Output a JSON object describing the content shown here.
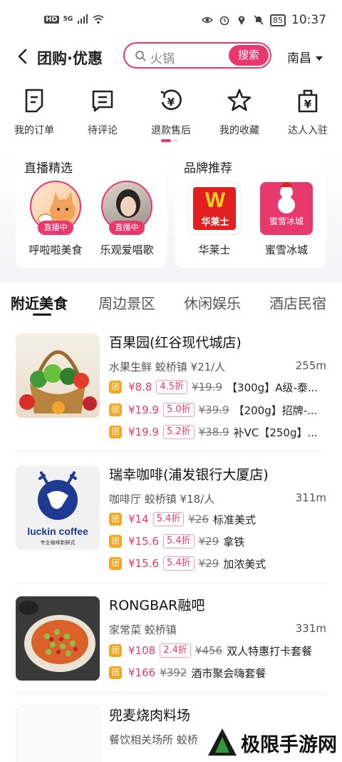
{
  "status_bar": {
    "left_icons": [
      "HD",
      "5G",
      "signal-icon",
      "wifi-icon"
    ],
    "battery": "85",
    "time": "10:37"
  },
  "header": {
    "title": "团购·优惠",
    "search_text": "火锅",
    "search_button": "搜索",
    "city": "南昌"
  },
  "quick_nav": [
    {
      "label": "我的订单",
      "icon": "order-icon"
    },
    {
      "label": "待评论",
      "icon": "comment-icon"
    },
    {
      "label": "退款售后",
      "icon": "refund-icon"
    },
    {
      "label": "我的收藏",
      "icon": "star-icon"
    },
    {
      "label": "达人入驻",
      "icon": "bag-icon"
    }
  ],
  "live_section": {
    "title": "直播精选",
    "items": [
      {
        "name": "呼啦啦美食",
        "tag": "直播中"
      },
      {
        "name": "乐观爱唱歌",
        "tag": "直播中"
      }
    ]
  },
  "brand_section": {
    "title": "品牌推荐",
    "items": [
      {
        "name": "华莱士",
        "logo_text": "华莱士",
        "logo_mark": "W"
      },
      {
        "name": "蜜雪冰城",
        "logo_text": "蜜雪冰城"
      }
    ]
  },
  "tabs": [
    "附近美食",
    "周边景区",
    "休闲娱乐",
    "酒店民宿"
  ],
  "stores": [
    {
      "name": "百果园(红谷现代城店)",
      "category": "水果生鲜 蛟桥镇 ¥21/人",
      "distance": "255m",
      "deals": [
        {
          "price": "¥8.8",
          "discount": "4.5折",
          "original": "¥19.9",
          "title": "【300g】A级-泰..."
        },
        {
          "price": "¥19.9",
          "discount": "5.0折",
          "original": "¥39.9",
          "title": "【200g】招牌-..."
        },
        {
          "price": "¥19.9",
          "discount": "5.2折",
          "original": "¥38.9",
          "title": "补VC【250g】..."
        }
      ]
    },
    {
      "name": "瑞幸咖啡(浦发银行大厦店)",
      "category": "咖啡厅 蛟桥镇 ¥18/人",
      "distance": "311m",
      "logo_text": "luckin coffee",
      "logo_sub": "专业咖啡新鲜式",
      "deals": [
        {
          "price": "¥14",
          "discount": "5.4折",
          "original": "¥26",
          "title": "标准美式"
        },
        {
          "price": "¥15.6",
          "discount": "5.4折",
          "original": "¥29",
          "title": "拿铁"
        },
        {
          "price": "¥15.6",
          "discount": "5.4折",
          "original": "¥29",
          "title": "加浓美式"
        }
      ]
    },
    {
      "name": "RONGBAR融吧",
      "category": "家常菜 蛟桥镇",
      "distance": "331m",
      "deals": [
        {
          "price": "¥108",
          "discount": "2.4折",
          "original": "¥456",
          "title": "双人特惠打卡套餐"
        },
        {
          "price": "¥166",
          "discount": "",
          "original": "¥392",
          "title": "酒市聚会嗨套餐"
        }
      ]
    },
    {
      "name": "兜麦烧肉料场",
      "category": "餐饮相关场所 蛟桥"
    }
  ],
  "deal_badge": "团",
  "watermark": "极限手游网"
}
